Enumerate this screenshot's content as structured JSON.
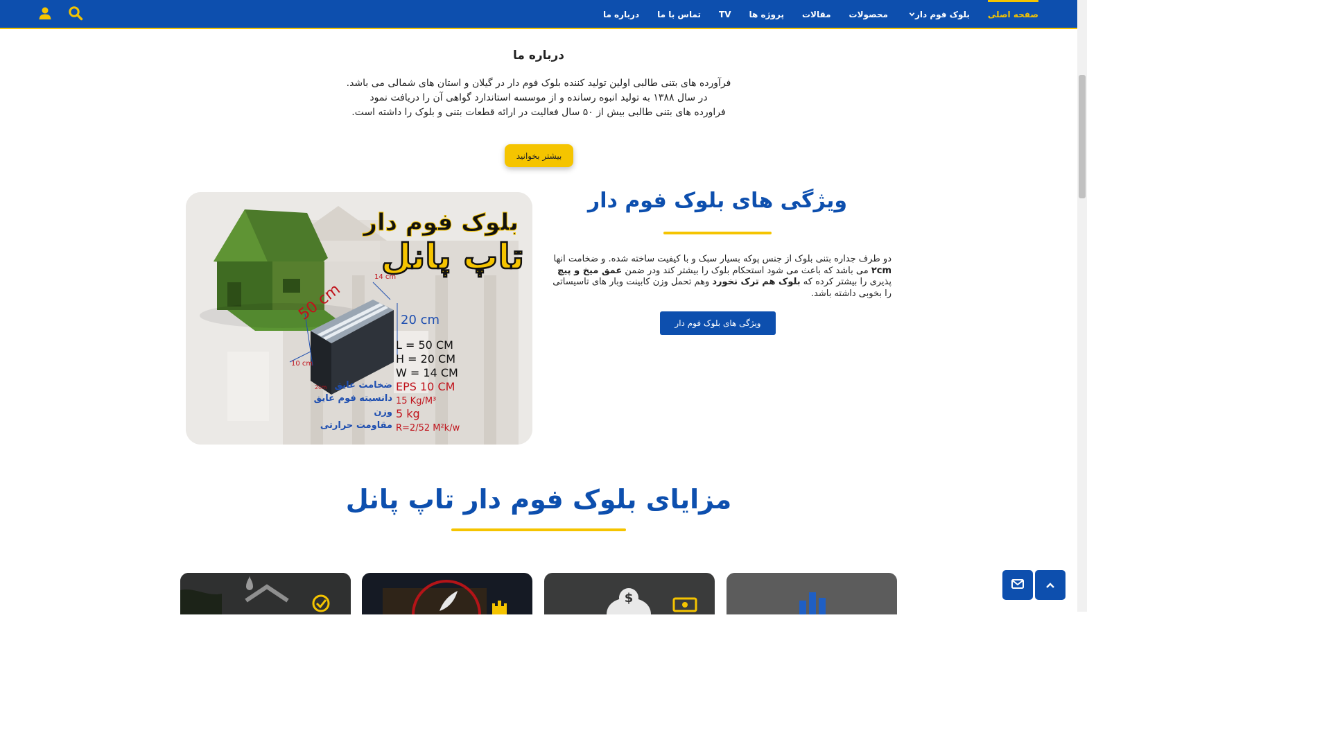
{
  "nav": {
    "items": [
      {
        "label": "صفحه اصلی",
        "active": true
      },
      {
        "label": "بلوک فوم دار",
        "has_dropdown": true
      },
      {
        "label": "محصولات"
      },
      {
        "label": "مقالات"
      },
      {
        "label": "پروژه ها"
      },
      {
        "label": "TV"
      },
      {
        "label": "تماس با ما"
      },
      {
        "label": "درباره ما"
      }
    ],
    "search_icon": "search-icon",
    "user_icon": "user-icon"
  },
  "about": {
    "title": "درباره ما",
    "lines": [
      "فرآورده های بتنی طالبی اولین تولید کننده بلوک فوم دار در گیلان و استان های شمالی می باشد.",
      "در سال ۱۳۸۸ به تولید انبوه رسانده و از موسسه استاندارد گواهی آن را دریافت نمود",
      "فراورده های بتنی طالبی بیش از ۵۰ سال فعالیت در ارائه قطعات بتنی و بلوک را داشته است."
    ],
    "button_label": "بیشتر بخوانید"
  },
  "product_image": {
    "brand_line1": "بلوک فوم دار",
    "brand_line2": "تاپ پانل",
    "dim_14": "14 cm",
    "dim_50": "50 cm",
    "dim_20": "20 cm",
    "dim_10": "10 cm",
    "dim_2": "2cm",
    "specs": [
      {
        "label": "",
        "value": "L = 50 CM"
      },
      {
        "label": "",
        "value": "H = 20 CM"
      },
      {
        "label": "",
        "value": "W = 14 CM"
      },
      {
        "label": "ضخامت عایق",
        "value": "EPS 10 CM"
      },
      {
        "label": "دانسیته فوم عایق",
        "value": "15 Kg/M³"
      },
      {
        "label": "وزن",
        "value": "5 kg"
      },
      {
        "label": "مقاومت حرارتی",
        "value": "R=2/52 M²k/w"
      }
    ]
  },
  "features": {
    "title": "ویژگی های بلوک فوم دار",
    "desc_part1": "دو طرف جداره بتنی بلوک از جنس پوکه بسیار سبک و با کیفیت ساخته شده. و ضخامت انها ",
    "desc_bold1": "۲cm",
    "desc_part2": " می باشد که باعث می شود استحکام بلوک را بیشتر کند ودر ضمن ",
    "desc_bold2": "عمق میخ و پیچ",
    "desc_part3": " پذیری را بیشتر کرده که ",
    "desc_bold3": "بلوک هم ترک نخورد",
    "desc_part4": " وهم تحمل وزن کابینت وبار های تاسیساتی را بخوبی داشته باشد.",
    "button_label": "ویژگی های بلوک فوم دار"
  },
  "advantages": {
    "title": "مزایای بلوک فوم دار تاپ پانل",
    "cards": [
      {
        "icon": "house-drop-icon",
        "badge": "check-circle-icon"
      },
      {
        "icon": "feather-icon",
        "badge": "castle-icon"
      },
      {
        "icon": "money-bag-icon",
        "badge": "banknote-icon"
      },
      {
        "icon": "chart-bars-icon",
        "badge": ""
      }
    ]
  },
  "floating": {
    "mail_icon": "mail-icon",
    "top_icon": "chevron-up-icon"
  },
  "colors": {
    "primary": "#0d4fae",
    "accent": "#f5c400"
  }
}
